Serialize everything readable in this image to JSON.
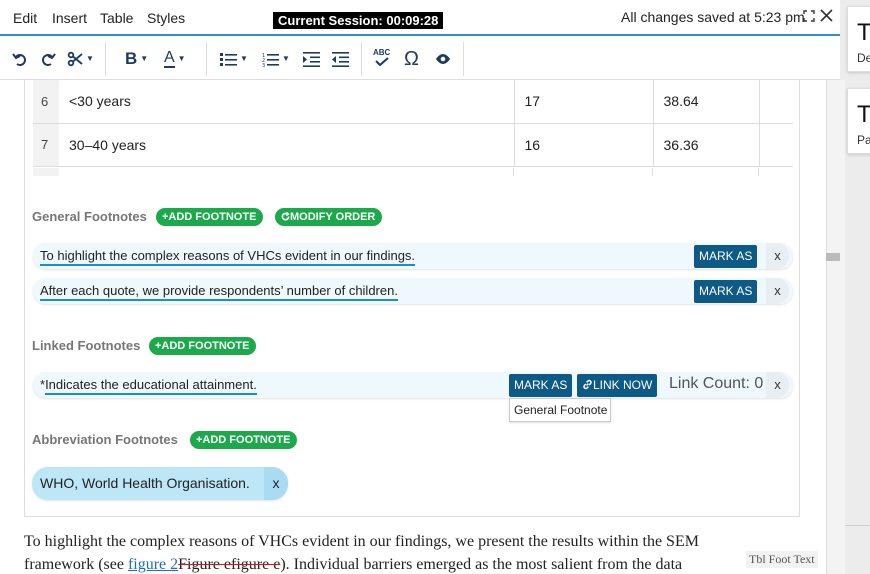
{
  "menu": {
    "items": [
      "Edit",
      "Insert",
      "Table",
      "Styles"
    ]
  },
  "session": {
    "label": "Current Session: 00:09:28"
  },
  "status": {
    "saved_text": "All changes saved at 5:23 pm"
  },
  "toolbar": {
    "icons": [
      "undo-icon",
      "redo-icon",
      "scissors-icon",
      "bold-icon",
      "font-color-icon",
      "bulleted-list-icon",
      "numbered-list-icon",
      "indent-icon",
      "outdent-icon",
      "spellcheck-icon",
      "omega-icon",
      "eye-icon"
    ],
    "bold_label": "B",
    "font_color_label": "A",
    "spell_label": "ABC",
    "omega_label": "Ω"
  },
  "table": {
    "rows": [
      {
        "num": "6",
        "label": "<30 years",
        "n": "17",
        "pct": "38.64"
      },
      {
        "num": "7",
        "label": "30–40 years",
        "n": "16",
        "pct": "36.36"
      }
    ]
  },
  "general_footnotes": {
    "label": "General Footnotes",
    "add_label": "+ADD FOOTNOTE",
    "modify_label": "MODIFY ORDER",
    "items": [
      {
        "text": "To highlight the complex reasons of VHCs evident in our findings.",
        "mark_label": "MARK AS",
        "close_label": "x"
      },
      {
        "text": "After each quote, we provide respondents’ number of children.",
        "mark_label": "MARK AS",
        "close_label": "x"
      }
    ]
  },
  "linked_footnotes": {
    "label": "Linked Footnotes",
    "add_label": "+ADD FOOTNOTE",
    "items": [
      {
        "prefix": "*",
        "text": "Indicates the educational attainment.",
        "mark_label": "MARK AS",
        "link_label": "LINK NOW",
        "link_count": "Link Count: 0",
        "close_label": "x"
      }
    ],
    "tooltip": "General Footnote"
  },
  "abbreviation_footnotes": {
    "label": "Abbreviation Footnotes",
    "add_label": "+ADD FOOTNOTE",
    "items": [
      {
        "text": "WHO, World Health Organisation.",
        "close_label": "x"
      }
    ]
  },
  "body_text": {
    "line1": "To highlight the complex reasons of VHCs evident in our findings, we present the results within the SEM",
    "line2_a": "framework (see ",
    "line2_link": "figure 2",
    "line2_strike": "Figure efigure e",
    "line2_b": "). Individual barriers emerged as the most salient from the data",
    "style_label": "Tbl Foot Text"
  },
  "side_panel": {
    "cards": [
      {
        "big": "Ta",
        "small": "De"
      },
      {
        "big": "Ta",
        "small": "Pa"
      }
    ]
  }
}
